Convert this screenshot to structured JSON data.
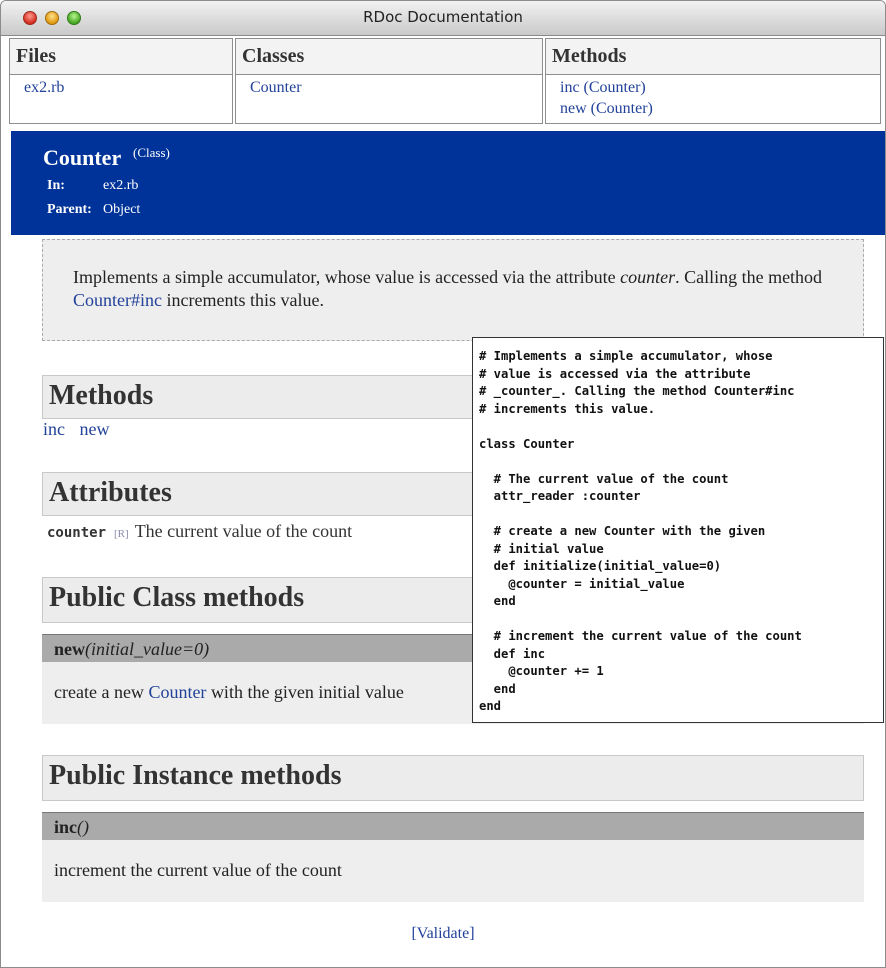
{
  "window": {
    "title": "RDoc Documentation"
  },
  "frames": {
    "files": {
      "heading": "Files",
      "items": [
        "ex2.rb"
      ]
    },
    "classes": {
      "heading": "Classes",
      "items": [
        "Counter"
      ]
    },
    "methods": {
      "heading": "Methods",
      "items": [
        "inc (Counter)",
        "new (Counter)"
      ]
    }
  },
  "banner": {
    "name": "Counter",
    "type": "(Class)",
    "in_label": "In:",
    "in_value": "ex2.rb",
    "parent_label": "Parent:",
    "parent_value": "Object"
  },
  "description": {
    "part1": "Implements a simple accumulator, whose value is accessed via the attribute ",
    "attr": "counter",
    "part2": ". Calling the method ",
    "link": "Counter#inc",
    "part3": " increments this value."
  },
  "methods_section": {
    "heading": "Methods",
    "links": [
      "inc",
      "new"
    ]
  },
  "attributes_section": {
    "heading": "Attributes",
    "name": "counter",
    "rw": "[R]",
    "desc": "The current value of the count"
  },
  "public_class_methods": {
    "heading": "Public Class methods",
    "method_name": "new",
    "method_args": "(initial_value=0)",
    "desc_pre": "create a new ",
    "desc_link": "Counter",
    "desc_post": " with the given initial value"
  },
  "public_instance_methods": {
    "heading": "Public Instance methods",
    "method_name": "inc",
    "method_args": "()",
    "desc": "increment the current value of the count"
  },
  "footer": {
    "validate": "[Validate]"
  },
  "source_code": "# Implements a simple accumulator, whose\n# value is accessed via the attribute\n# _counter_. Calling the method Counter#inc\n# increments this value.\n\nclass Counter\n\n  # The current value of the count\n  attr_reader :counter\n\n  # create a new Counter with the given\n  # initial value\n  def initialize(initial_value=0)\n    @counter = initial_value\n  end\n\n  # increment the current value of the count\n  def inc\n    @counter += 1\n  end\nend"
}
